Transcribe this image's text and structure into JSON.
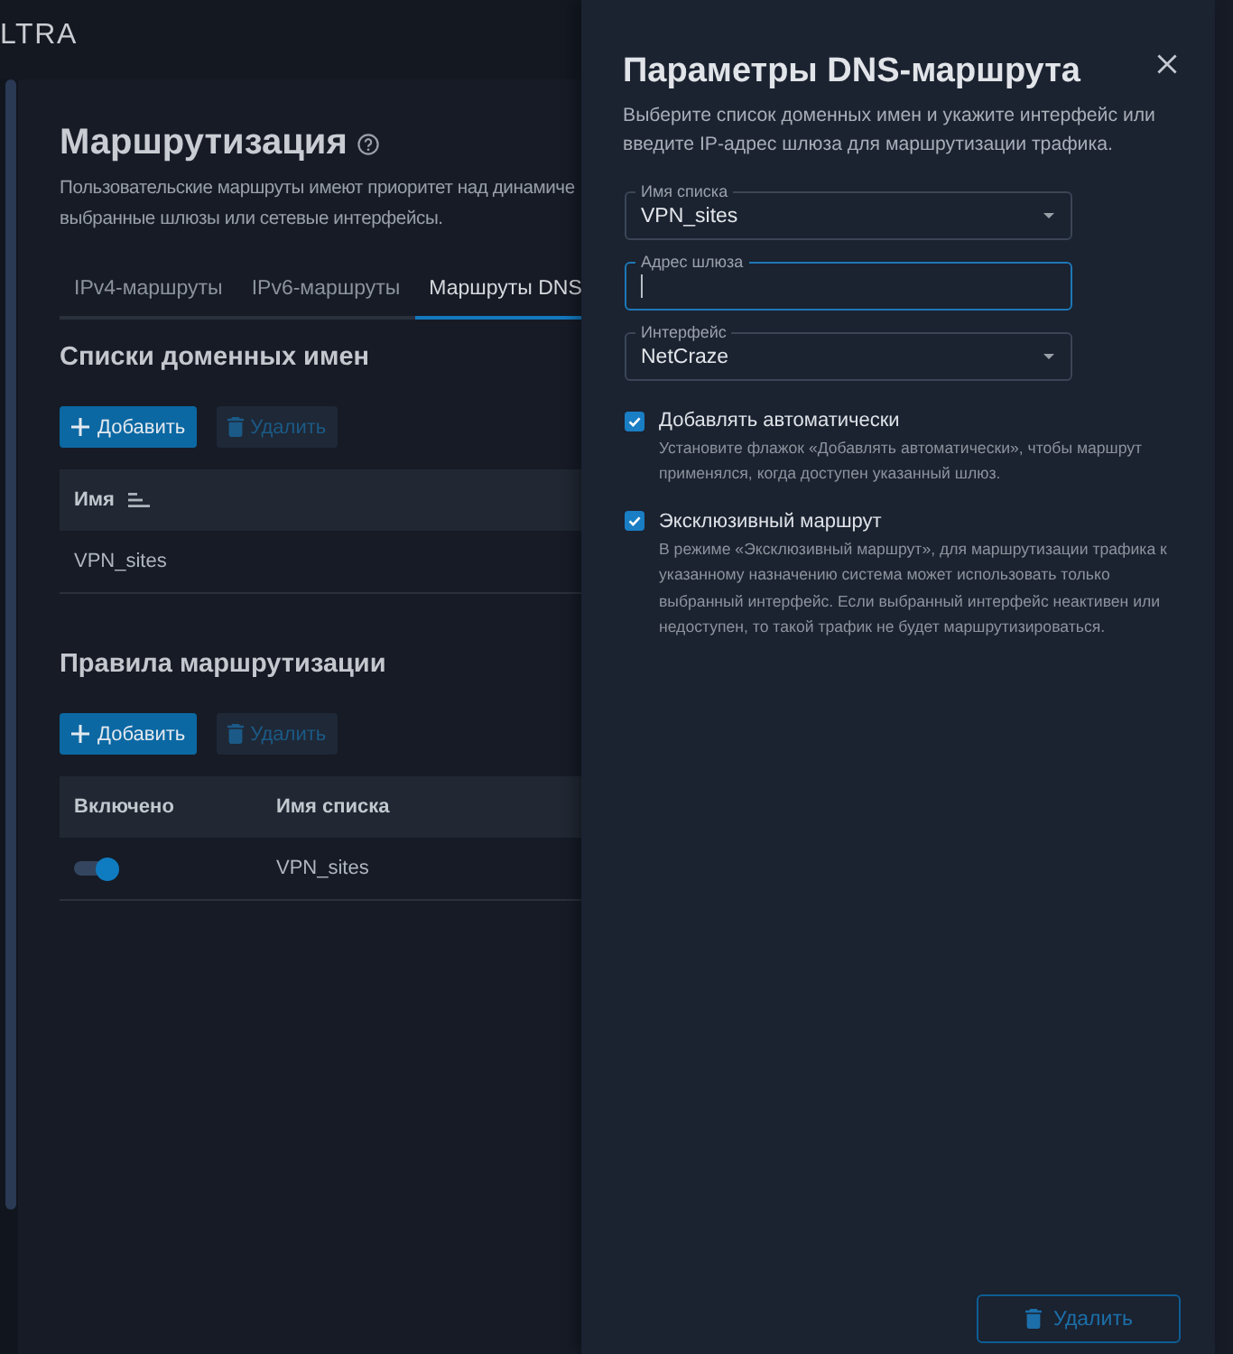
{
  "header": {
    "logo": "LTRA"
  },
  "page": {
    "title": "Маршрутизация",
    "description_lines": [
      "Пользовательские маршруты имеют приоритет над динамиче",
      "выбранные шлюзы или сетевые интерфейсы."
    ]
  },
  "tabs": [
    {
      "label": "IPv4-маршруты",
      "selected": false
    },
    {
      "label": "IPv6-маршруты",
      "selected": false
    },
    {
      "label": "Маршруты DNS",
      "selected": true
    }
  ],
  "domain_lists": {
    "title": "Списки доменных имен",
    "buttons": [
      {
        "kind": "add",
        "label": "Добавить",
        "disabled": false
      },
      {
        "kind": "delete",
        "label": "Удалить",
        "disabled": true
      }
    ],
    "table": {
      "columns": [
        {
          "label": "Имя",
          "sortable": true
        }
      ],
      "rows": [
        {
          "name": "VPN_sites"
        }
      ]
    }
  },
  "routing_rules": {
    "title": "Правила маршрутизации",
    "buttons": [
      {
        "kind": "add",
        "label": "Добавить",
        "disabled": false
      },
      {
        "kind": "delete",
        "label": "Удалить",
        "disabled": true
      }
    ],
    "table": {
      "columns": [
        {
          "label": "Включено",
          "sortable": false
        },
        {
          "label": "Имя списка",
          "sortable": false
        }
      ],
      "rows": [
        {
          "enabled": true,
          "list_name": "VPN_sites"
        }
      ]
    }
  },
  "dialog": {
    "title": "Параметры DNS-маршрута",
    "description": "Выберите список доменных имен и укажите интерфейс или введите IP-адрес шлюза для маршрутизации трафика.",
    "fields": [
      {
        "kind": "select",
        "label": "Имя списка",
        "value": "VPN_sites",
        "focused": false
      },
      {
        "kind": "text",
        "label": "Адрес шлюза",
        "focused": true
      },
      {
        "kind": "select",
        "label": "Интерфейс",
        "value": "NetCraze",
        "focused": false
      }
    ],
    "options": [
      {
        "label": "Добавлять автоматически",
        "hint": "Установите флажок «Добавлять автоматически», чтобы маршрут применялся, когда доступен указанный шлюз.",
        "checked": true
      },
      {
        "label": "Эксклюзивный маршрут",
        "hint": "В режиме «Эксклюзивный маршрут», для маршрутизации трафика к указанному назначению система может использовать только выбранный интерфейс. Если выбранный интерфейс неактивен или недоступен, то такой трафик не будет маршрутизироваться.",
        "checked": true
      }
    ],
    "delete_button": {
      "label": "Удалить"
    }
  }
}
